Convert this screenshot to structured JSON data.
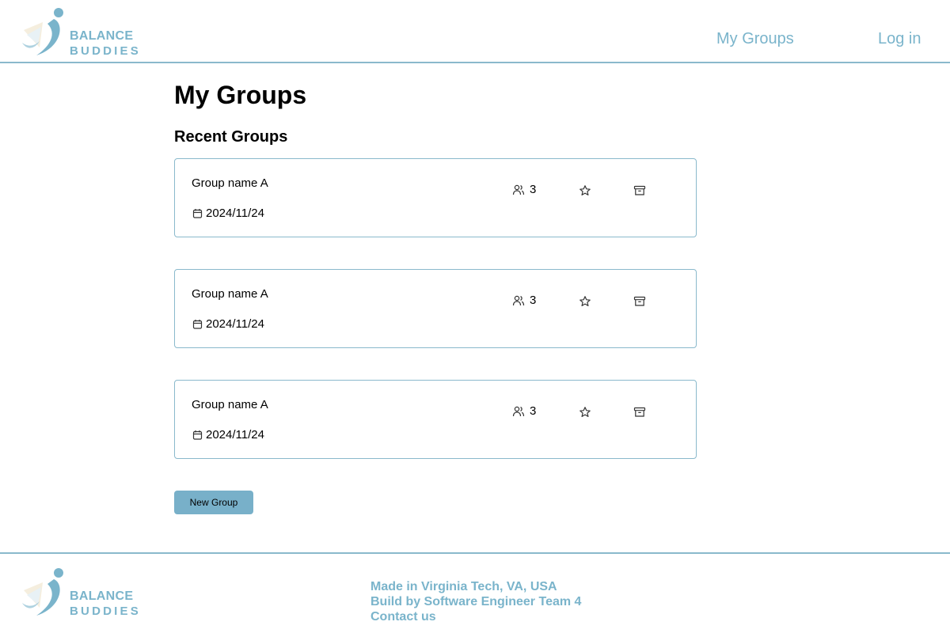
{
  "header": {
    "logo_line1": "BALANCE",
    "logo_line2": "BUDDIES",
    "nav_my_groups": "My Groups",
    "nav_login": "Log in"
  },
  "main": {
    "title": "My Groups",
    "section_title": "Recent Groups",
    "groups": [
      {
        "name": "Group name A",
        "date": "2024/11/24",
        "members": "3"
      },
      {
        "name": "Group name A",
        "date": "2024/11/24",
        "members": "3"
      },
      {
        "name": "Group name A",
        "date": "2024/11/24",
        "members": "3"
      }
    ],
    "new_group_label": "New Group"
  },
  "footer": {
    "logo_line1": "BALANCE",
    "logo_line2": "BUDDIES",
    "line1": "Made in Virginia Tech, VA, USA",
    "line2": "Build by Software Engineer Team 4",
    "contact": "Contact us"
  },
  "colors": {
    "accent": "#7ab4cb",
    "border": "#8ab9cc",
    "button": "#78b0c9"
  }
}
